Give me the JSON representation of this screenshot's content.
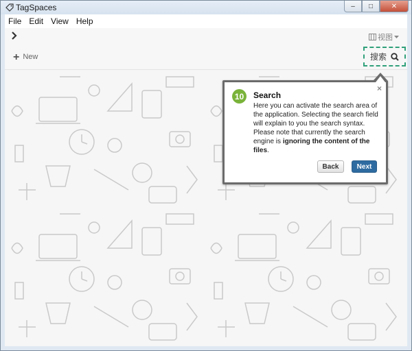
{
  "window": {
    "title": "TagSpaces",
    "minimize_glyph": "–",
    "maximize_glyph": "□",
    "close_glyph": "✕"
  },
  "menubar": {
    "items": [
      "File",
      "Edit",
      "View",
      "Help"
    ]
  },
  "toolbar": {
    "expand_icon": "chevron-right-icon",
    "view_label": "视图",
    "new_label": "New",
    "search_label": "搜索"
  },
  "tour": {
    "step_number": "10",
    "title": "Search",
    "body_text": "Here you can activate the search area of the application. Selecting the search field will explain to you the search syntax. Please note that currently the search engine is",
    "body_bold": "ignoring the content of the files",
    "body_end": ".",
    "close_glyph": "×",
    "back_label": "Back",
    "next_label": "Next"
  },
  "colors": {
    "accent_green": "#7ab33a",
    "primary_button": "#2e6ba0",
    "search_highlight": "#2fa07a"
  }
}
